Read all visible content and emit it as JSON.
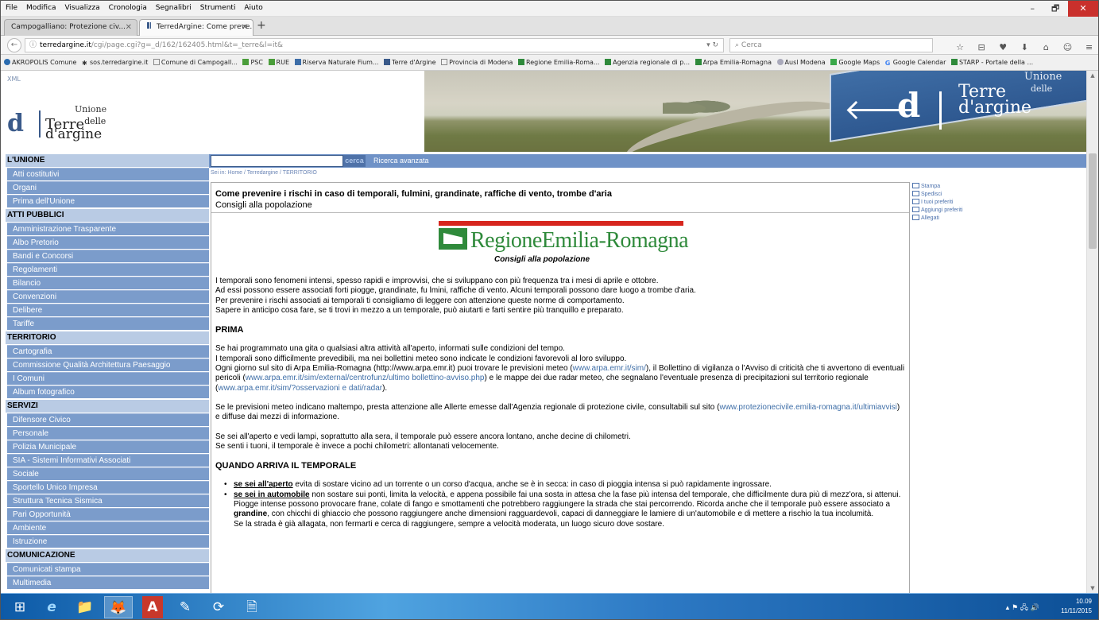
{
  "browser": {
    "menu": [
      "File",
      "Modifica",
      "Visualizza",
      "Cronologia",
      "Segnalibri",
      "Strumenti",
      "Aiuto"
    ],
    "window_controls": [
      "–",
      "🗗",
      "✕"
    ],
    "tabs": [
      {
        "label": "Campogalliano: Protezione civ...",
        "active": false
      },
      {
        "label": "TerredArgine: Come preve...",
        "active": true
      }
    ],
    "new_tab": "+",
    "url_domain": "terredargine.it",
    "url_path": "/cgi/page.cgi?g=_d/162/162405.html&t=_terre&l=it&",
    "search_placeholder": "Cerca",
    "nav_icons": [
      "☆",
      "⊟",
      "♥",
      "⬇",
      "⌂",
      "☺",
      "≡"
    ],
    "bookmarks": [
      "AKROPOLIS Comune",
      "sos.terredargine.it",
      "Comune di Campogall...",
      "PSC",
      "RUE",
      "Riserva Naturale Fium...",
      "Terre d'Argine",
      "Provincia di Modena",
      "Regione Emilia-Roma...",
      "Agenzia regionale di p...",
      "Arpa Emilia-Romagna",
      "Ausl Modena",
      "Google Maps",
      "Google Calendar",
      "STARP - Portale della ..."
    ]
  },
  "site": {
    "xml_link": "XML",
    "logo": {
      "symbol": "d",
      "unione": "Unione",
      "terre": "Terre",
      "delle": "delle",
      "argine": "d'argine"
    },
    "banner": {
      "symbol": "d",
      "unione": "Unione",
      "delle": "delle",
      "terre": "Terre",
      "argine": "d'argine"
    },
    "search_button": "cerca",
    "advanced_search": "Ricerca avanzata",
    "breadcrumb": "Sei in: Home / Terredargine / TERRITORIO",
    "nav": [
      {
        "heading": "L'UNIONE",
        "items": [
          "Atti costitutivi",
          "Organi",
          "Prima dell'Unione"
        ]
      },
      {
        "heading": "ATTI PUBBLICI",
        "items": [
          "Amministrazione Trasparente",
          "Albo Pretorio",
          "Bandi e Concorsi",
          "Regolamenti",
          "Bilancio",
          "Convenzioni",
          "Delibere",
          "Tariffe"
        ]
      },
      {
        "heading": "TERRITORIO",
        "items": [
          "Cartografia",
          "Commissione Qualità Architettura Paesaggio",
          "I Comuni",
          "Album fotografico"
        ]
      },
      {
        "heading": "SERVIZI",
        "items": [
          "Difensore Civico",
          "Personale",
          "Polizia Municipale",
          "SIA - Sistemi Informativi Associati",
          "Sociale",
          "Sportello Unico Impresa",
          "Struttura Tecnica Sismica",
          "Pari Opportunità",
          "Ambiente",
          "Istruzione"
        ]
      },
      {
        "heading": "COMUNICAZIONE",
        "items": [
          "Comunicati stampa",
          "Multimedia"
        ]
      }
    ],
    "tools": [
      "Stampa",
      "Spedisci",
      "I tuoi preferiti",
      "Aggiungi preferiti",
      "Allegati"
    ],
    "article": {
      "title": "Come prevenire i rischi in caso di temporali, fulmini, grandinate, raffiche di vento, trombe d'aria",
      "subtitle": "Consigli alla popolazione",
      "region_logo": "RegioneEmilia-Romagna",
      "region_caption": "Consigli alla popolazione",
      "intro": [
        "I temporali sono fenomeni intensi, spesso rapidi e improvvisi, che si sviluppano con più frequenza tra i mesi di aprile e ottobre.",
        "Ad essi possono essere associati forti piogge, grandinate, fu lmini, raffiche di vento. Alcuni temporali possono dare luogo a trombe d'aria.",
        "Per prevenire i rischi associati ai temporali ti consigliamo di leggere con attenzione queste norme di comportamento.",
        "Sapere in anticipo cosa fare, se ti trovi in mezzo a un temporale, può aiutarti e farti sentire più tranquillo e preparato."
      ],
      "h_prima": "PRIMA",
      "prima_1": "Se hai programmato una gita o qualsiasi altra attività all'aperto, informati sulle condizioni del tempo.",
      "prima_2": "I temporali sono difficilmente prevedibili, ma nei bollettini meteo sono indicate le condizioni favorevoli al loro sviluppo.",
      "prima_3a": "Ogni giorno sul sito di Arpa Emilia-Romagna (http://www.arpa.emr.it) puoi trovare le previsioni meteo (",
      "link_sim": "www.arpa.emr.it/sim/",
      "prima_3b": "), il Bollettino di vigilanza o l'Avviso di criticità che ti avvertono di eventuali pericoli (",
      "link_avviso": "www.arpa.emr.it/sim/external/centrofunz/ultimo bollettino-avviso.php",
      "prima_3c": ") e le mappe dei due radar meteo, che segnalano l'eventuale presenza di precipitazioni sul territorio regionale (",
      "link_radar": "www.arpa.emr.it/sim/?osservazioni e dati/radar",
      "prima_3d": ").",
      "allerte_a": "Se le previsioni meteo indicano maltempo, presta attenzione alle Allerte emesse dall'Agenzia regionale di protezione civile, consultabili sul sito (",
      "link_allerte": "www.protezionecivile.emilia-romagna.it/ultimiavvisi",
      "allerte_b": ") e diffuse dai mezzi di informazione.",
      "lampi_1": "Se sei all'aperto e vedi lampi, soprattutto alla sera, il temporale può essere ancora lontano, anche decine di chilometri.",
      "lampi_2": "Se senti i tuoni, il temporale è invece a pochi chilometri: allontanati velocemente.",
      "h_arriva": "QUANDO ARRIVA IL TEMPORALE",
      "b1_strong": "se sei all'aperto",
      "b1_text": " evita di sostare vicino ad un torrente o un corso d'acqua, anche se è in secca: in caso di pioggia intensa si può rapidamente ingrossare.",
      "b2_strong": "se sei in automobile",
      "b2_text": " non sostare sui ponti, limita la velocità, e appena possibile fai una sosta in attesa che la fase più intensa del temporale, che difficilmente dura più di mezz'ora, si attenui.",
      "piogge_a": "Piogge intense possono provocare frane, colate di fango e smottamenti che potrebbero raggiungere la strada che stai percorrendo. Ricorda anche che il temporale può essere associato a ",
      "piogge_strong": "grandine",
      "piogge_b": ", con chicchi di ghiaccio che possono raggiungere anche dimensioni ragguardevoli, capaci di danneggiare le lamiere di un'automobile e di mettere a rischio la tua incolumità.",
      "strada": "Se la strada è già allagata, non fermarti e cerca di raggiungere, sempre a velocità moderata, un luogo sicuro dove sostare."
    }
  },
  "taskbar": {
    "time": "10.09",
    "date": "11/11/2015",
    "apps": [
      "⊞",
      "e",
      "📁",
      "🦊",
      "A",
      "✎",
      "⟳",
      "🗎"
    ]
  }
}
